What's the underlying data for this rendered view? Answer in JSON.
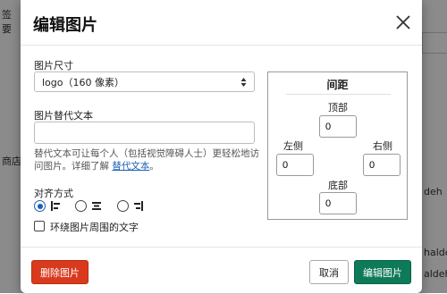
{
  "background": {
    "left_fragments": [
      "签",
      "要",
      "商店"
    ],
    "right_fragments": [
      "deh",
      "haldeh",
      "aldeh"
    ]
  },
  "modal": {
    "title": "编辑图片",
    "size_label": "图片尺寸",
    "size_value": "logo（160 像素）",
    "alt_label": "图片替代文本",
    "alt_value": "",
    "help_text": "替代文本可让每个人（包括视觉障碍人士）更轻松地访问图片。详细了解",
    "help_link": "替代文本",
    "help_suffix": "。",
    "align_label": "对齐方式",
    "align_selected": "left",
    "wrap_label": "环绕图片周围的文字",
    "wrap_checked": false,
    "spacing": {
      "title": "间距",
      "top_label": "顶部",
      "top_value": "0",
      "left_label": "左侧",
      "left_value": "0",
      "right_label": "右侧",
      "right_value": "0",
      "bottom_label": "底部",
      "bottom_value": "0"
    },
    "buttons": {
      "delete": "删除图片",
      "cancel": "取消",
      "edit": "编辑图片"
    }
  },
  "colors": {
    "accent": "#1a5fb4",
    "delete": "#d93a1e",
    "primary": "#0e7a5a"
  }
}
